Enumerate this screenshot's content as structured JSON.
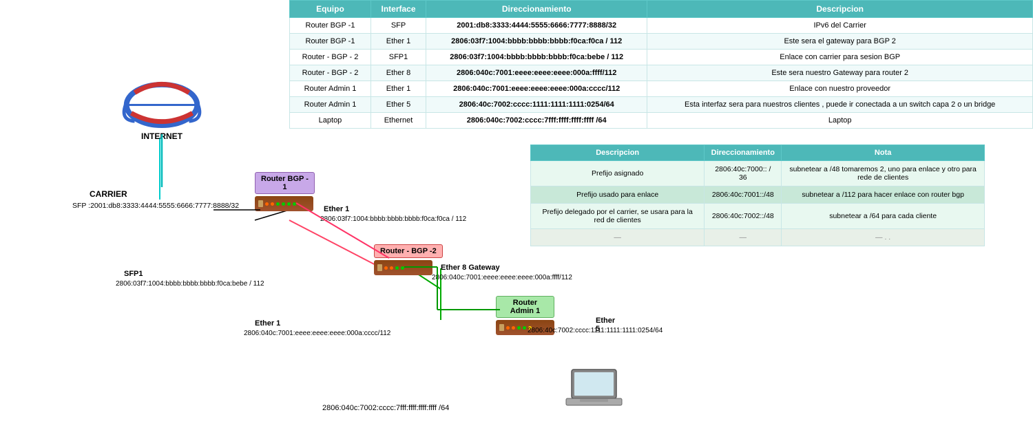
{
  "table": {
    "headers": [
      "Equipo",
      "Interface",
      "Direccionamiento",
      "Descripcion"
    ],
    "rows": [
      {
        "equipo": "Router BGP -1",
        "interface": "SFP",
        "direccionamiento": "2001:db8:3333:4444:5555:6666:7777:8888/32",
        "descripcion": "IPv6 del Carrier"
      },
      {
        "equipo": "Router BGP -1",
        "interface": "Ether 1",
        "direccionamiento": "2806:03f7:1004:bbbb:bbbb:bbbb:f0ca:f0ca / 112",
        "descripcion": "Este sera el gateway para BGP 2"
      },
      {
        "equipo": "Router - BGP - 2",
        "interface": "SFP1",
        "direccionamiento": "2806:03f7:1004:bbbb:bbbb:bbbb:f0ca:bebe / 112",
        "descripcion": "Enlace con carrier para sesion BGP"
      },
      {
        "equipo": "Router - BGP - 2",
        "interface": "Ether 8",
        "direccionamiento": "2806:040c:7001:eeee:eeee:eeee:000a:ffff/112",
        "descripcion": "Este sera nuestro Gateway para router 2"
      },
      {
        "equipo": "Router Admin 1",
        "interface": "Ether 1",
        "direccionamiento": "2806:040c:7001:eeee:eeee:eeee:000a:cccc/112",
        "descripcion": "Enlace con nuestro proveedor"
      },
      {
        "equipo": "Router Admin 1",
        "interface": "Ether 5",
        "direccionamiento": "2806:40c:7002:cccc:1111:1111:1111:0254/64",
        "descripcion": "Esta interfaz sera para nuestros clientes , puede ir conectada a un switch capa 2 o un bridge"
      },
      {
        "equipo": "Laptop",
        "interface": "Ethernet",
        "direccionamiento": "2806:040c:7002:cccc:7fff:ffff:ffff:ffff /64",
        "descripcion": "Laptop"
      }
    ]
  },
  "second_table": {
    "headers": [
      "Descripcion",
      "Direccionamiento",
      "Nota"
    ],
    "rows": [
      {
        "descripcion": "Prefijo asignado",
        "direccionamiento": "2806:40c:7000:: / 36",
        "nota": "subnetear a /48  tomaremos 2, uno para enlace y otro para rede de clientes"
      },
      {
        "descripcion": "Prefijo usado para enlace",
        "direccionamiento": "2806:40c:7001::/48",
        "nota": "subnetear a /112 para hacer enlace con router bgp"
      },
      {
        "descripcion": "Prefijo delegado por el carrier, se usara para la red de clientes",
        "direccionamiento": "2806:40c:7002::/48",
        "nota": "subnetear a /64 para cada cliente"
      },
      {
        "descripcion": "—",
        "direccionamiento": "—",
        "nota": "— . ."
      }
    ]
  },
  "diagram": {
    "internet_label": "INTERNET",
    "carrier_label": "CARRIER",
    "carrier_sfp": "SFP :2001:db8:3333:4444:5555:6666:7777:8888/32",
    "router_bgp1_label": "Router BGP -\n1",
    "router_bgp2_label": "Router - BGP -2",
    "router_admin1_label": "Router Admin 1",
    "ether1_bgp1_label": "Ether 1",
    "ether1_bgp1_addr": "2806:03f7:1004:bbbb:bbbb:bbbb:f0ca:f0ca / 112",
    "sfp1_bgp2_label": "SFP1",
    "sfp1_bgp2_addr": "2806:03f7:1004:bbbb:bbbb:bbbb:f0ca:bebe / 112",
    "ether8_label": "Ether 8 Gateway",
    "ether8_addr": "2806:040c:7001:eeee:eeee:eeee:000a:ffff/112",
    "ether1_admin_label": "Ether 1",
    "ether1_admin_addr": "2806:040c:7001:eeee:eeee:eeee:000a:cccc/112",
    "ether5_label": "Ether 5",
    "ether5_addr": "2806:40c:7002:cccc:1111:1111:1111:0254/64",
    "laptop_addr": "2806:040c:7002:cccc:7fff:ffff:ffff:ffff /64"
  }
}
